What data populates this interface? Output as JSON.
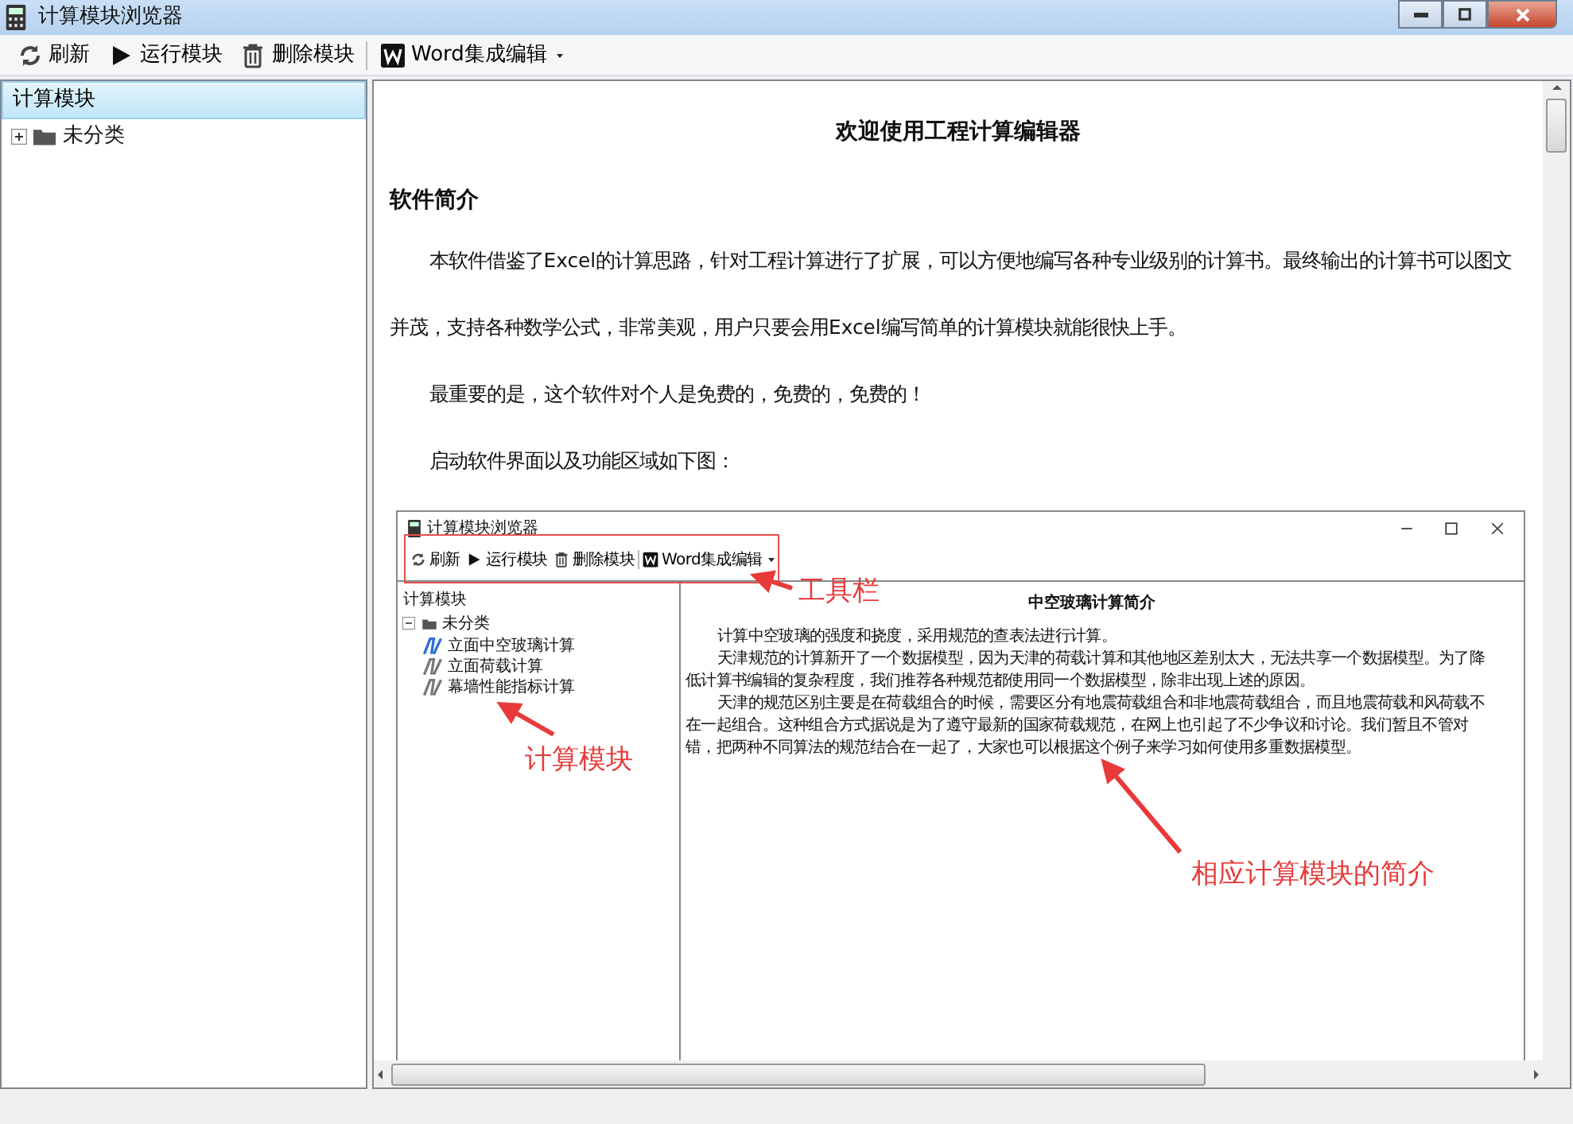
{
  "window": {
    "title": "计算模块浏览器"
  },
  "toolbar": [
    {
      "kind": "refresh",
      "label": "刷新"
    },
    {
      "kind": "run",
      "label": "运行模块"
    },
    {
      "kind": "delete",
      "label": "删除模块"
    },
    {
      "kind": "word",
      "label": "Word集成编辑"
    }
  ],
  "tree": {
    "header": {
      "label": "计算模块",
      "selected": true
    },
    "items": [
      {
        "label": "未分类",
        "expanded": false
      }
    ]
  },
  "document": {
    "title": "欢迎使用工程计算编辑器",
    "heading": "软件简介",
    "paragraphs": [
      "本软件借鉴了Excel的计算思路，针对工程计算进行了扩展，可以方便地编写各种专业级别的计算书。最终输出的计算书可以图文并茂，支持各种数学公式，非常美观，用户只要会用Excel编写简单的计算模块就能很快上手。",
      "最重要的是，这个软件对个人是免费的，免费的，免费的！",
      "启动软件界面以及功能区域如下图："
    ],
    "screenshot": {
      "window_title": "计算模块浏览器",
      "toolbar": [
        {
          "kind": "refresh",
          "label": "刷新"
        },
        {
          "kind": "run",
          "label": "运行模块"
        },
        {
          "kind": "delete",
          "label": "删除模块"
        },
        {
          "kind": "word",
          "label": "Word集成编辑"
        }
      ],
      "tree": {
        "header": "计算模块",
        "items": [
          {
            "label": "未分类",
            "expanded": true,
            "children": [
              {
                "label": "立面中空玻璃计算",
                "selected": true
              },
              {
                "label": "立面荷载计算",
                "selected": false
              },
              {
                "label": "幕墙性能指标计算",
                "selected": false
              }
            ]
          }
        ]
      },
      "title": "中空玻璃计算简介",
      "paragraphs": [
        "计算中空玻璃的强度和挠度，采用规范的查表法进行计算。",
        "天津规范的计算新开了一个数据模型，因为天津的荷载计算和其他地区差别太大，无法共享一个数据模型。为了降低计算书编辑的复杂程度，我们推荐各种规范都使用同一个数据模型，除非出现上述的原因。",
        "天津的规范区别主要是在荷载组合的时候，需要区分有地震荷载组合和非地震荷载组合，而且地震荷载和风荷载不在一起组合。这种组合方式据说是为了遵守最新的国家荷载规范，在网上也引起了不少争议和讨论。我们暂且不管对错，把两种不同算法的规范结合在一起了，大家也可以根据这个例子来学习如何使用多重数据模型。"
      ],
      "callouts": [
        {
          "kind": "toolbar",
          "label": "工具栏"
        },
        {
          "kind": "tree",
          "label": "计算模块"
        },
        {
          "kind": "content",
          "label": "相应计算模块的简介"
        }
      ]
    }
  }
}
